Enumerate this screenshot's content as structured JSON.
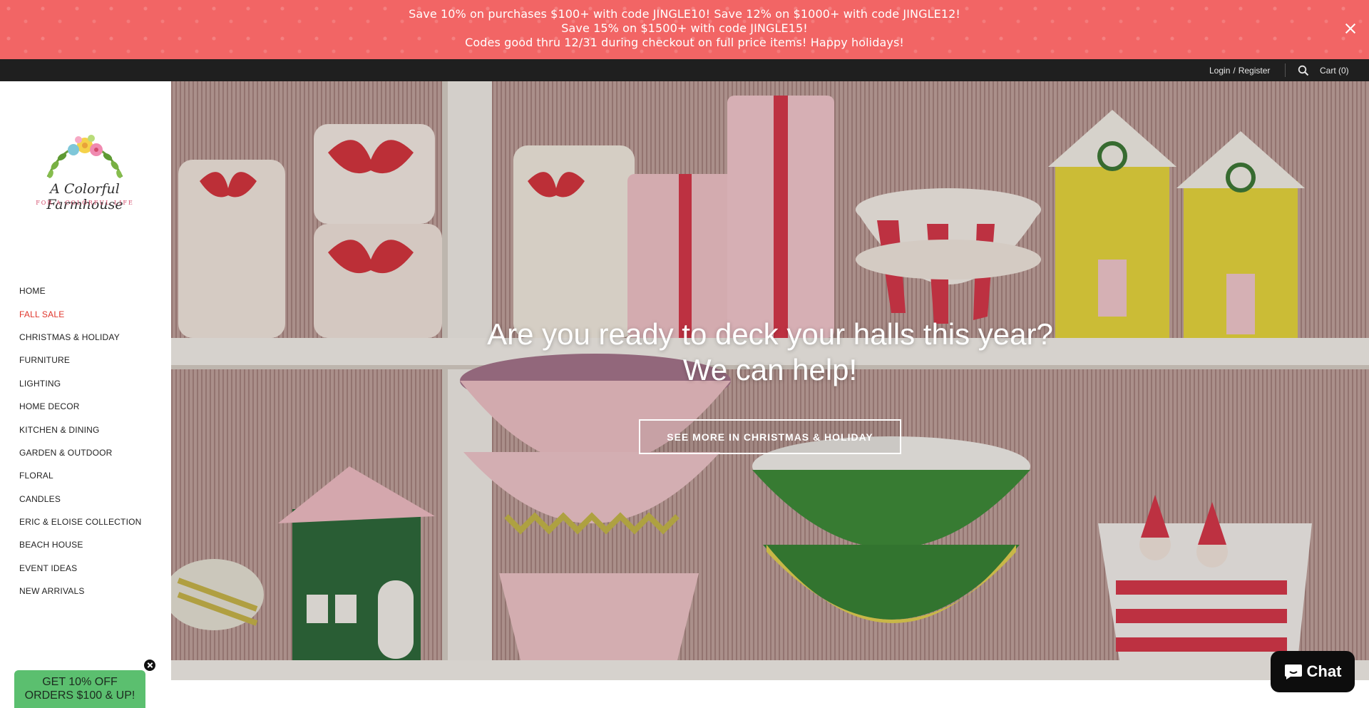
{
  "promo": {
    "line1": "Save 10% on purchases $100+ with code JINGLE10! Save 12% on $1000+ with code JINGLE12!",
    "line2": "Save 15% on $1500+ with code JINGLE15!",
    "line3": "Codes good thru 12/31 during checkout on full price items! Happy holidays!"
  },
  "topbar": {
    "login": "Login",
    "separator": "/",
    "register": "Register",
    "search_icon": "search-icon",
    "cart": "Cart (0)"
  },
  "brand": {
    "name": "A Colorful Farmhouse",
    "tagline": "FOR A COLORFUL LIFE"
  },
  "nav": {
    "items": [
      {
        "label": "HOME"
      },
      {
        "label": "FALL SALE"
      },
      {
        "label": "CHRISTMAS & HOLIDAY"
      },
      {
        "label": "FURNITURE"
      },
      {
        "label": "LIGHTING"
      },
      {
        "label": "HOME DECOR"
      },
      {
        "label": "KITCHEN & DINING"
      },
      {
        "label": "GARDEN & OUTDOOR"
      },
      {
        "label": "FLORAL"
      },
      {
        "label": "CANDLES"
      },
      {
        "label": "ERIC & ELOISE COLLECTION"
      },
      {
        "label": "BEACH HOUSE"
      },
      {
        "label": "EVENT IDEAS"
      },
      {
        "label": "NEW ARRIVALS"
      }
    ],
    "sale_color": "#e0352b"
  },
  "hero": {
    "headline_line1": "Are you ready to deck your halls this year?",
    "headline_line2": "We can help!",
    "button_label": "SEE MORE IN CHRISTMAS & HOLIDAY"
  },
  "popup": {
    "line1": "GET 10% OFF",
    "line2": "ORDERS $100 & UP!"
  },
  "chat": {
    "label": "Chat",
    "icon": "chat-bubble-icon"
  },
  "colors": {
    "promo_bg": "#f26565",
    "topbar_bg": "#1f1f1f",
    "popup_bg": "#5bbf6f",
    "chat_bg": "#0d0d0d"
  }
}
